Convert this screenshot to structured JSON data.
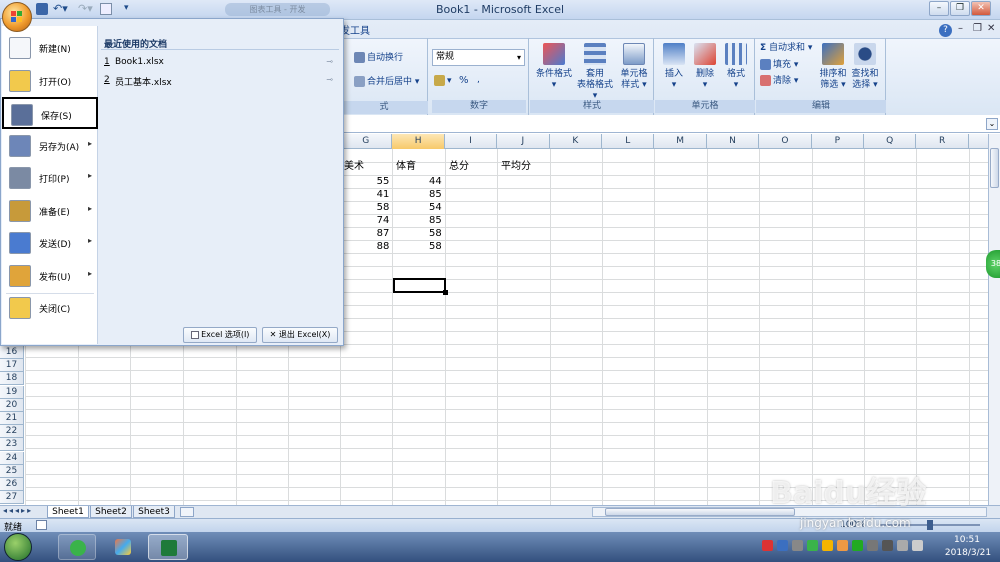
{
  "window": {
    "title": "Book1 - Microsoft Excel"
  },
  "qat": {
    "ghost_tab": "图表工具 - 开发"
  },
  "ribbon": {
    "tab_dev": "发工具",
    "alignment": {
      "wrap": "自动换行",
      "merge": "合并后居中",
      "label": "式"
    },
    "number": {
      "format": "常规",
      "percent": "%",
      "label": "数字"
    },
    "styles": {
      "cond": "条件格式",
      "table1": "套用",
      "table2": "表格格式",
      "cell1": "单元格",
      "cell2": "样式",
      "label": "样式"
    },
    "cells": {
      "insert": "插入",
      "delete": "删除",
      "format": "格式",
      "label": "单元格"
    },
    "editing": {
      "autosum": "自动求和",
      "fill": "填充",
      "clear": "清除",
      "sort1": "排序和",
      "sort2": "筛选",
      "find1": "查找和",
      "find2": "选择",
      "label": "编辑"
    }
  },
  "columns": [
    "G",
    "H",
    "I",
    "J",
    "K",
    "L",
    "M",
    "N",
    "O",
    "P",
    "Q",
    "R"
  ],
  "rows_visible": [
    "16",
    "17",
    "18",
    "19",
    "20",
    "21",
    "22",
    "23",
    "24",
    "25",
    "26",
    "27"
  ],
  "sheet_data": {
    "headers": {
      "G": "美术",
      "H": "体育",
      "I": "总分",
      "J": "平均分"
    },
    "values": [
      [
        "55",
        "44"
      ],
      [
        "41",
        "85"
      ],
      [
        "58",
        "54"
      ],
      [
        "74",
        "85"
      ],
      [
        "87",
        "58"
      ],
      [
        "88",
        "58"
      ]
    ]
  },
  "office_menu": {
    "items": [
      {
        "label": "新建(N)",
        "arrow": ""
      },
      {
        "label": "打开(O)",
        "arrow": ""
      },
      {
        "label": "保存(S)",
        "arrow": ""
      },
      {
        "label": "另存为(A)",
        "arrow": "▸"
      },
      {
        "label": "打印(P)",
        "arrow": "▸"
      },
      {
        "label": "准备(E)",
        "arrow": "▸"
      },
      {
        "label": "发送(D)",
        "arrow": "▸"
      },
      {
        "label": "发布(U)",
        "arrow": "▸"
      },
      {
        "label": "关闭(C)",
        "arrow": ""
      }
    ],
    "recent_title": "最近使用的文档",
    "recent": [
      {
        "num": "1",
        "name": "Book1.xlsx"
      },
      {
        "num": "2",
        "name": "员工基本.xlsx"
      }
    ],
    "options_btn": "Excel 选项(I)",
    "exit_btn": "退出 Excel(X)"
  },
  "sheets": [
    "Sheet1",
    "Sheet2",
    "Sheet3"
  ],
  "status": {
    "ready": "就绪",
    "zoom": "100%"
  },
  "watermark": {
    "main": "Baidu经验",
    "sub": "jingyan.baidu.com"
  },
  "clock": {
    "time": "10:51",
    "date": "2018/3/21"
  },
  "side_badge": "38"
}
